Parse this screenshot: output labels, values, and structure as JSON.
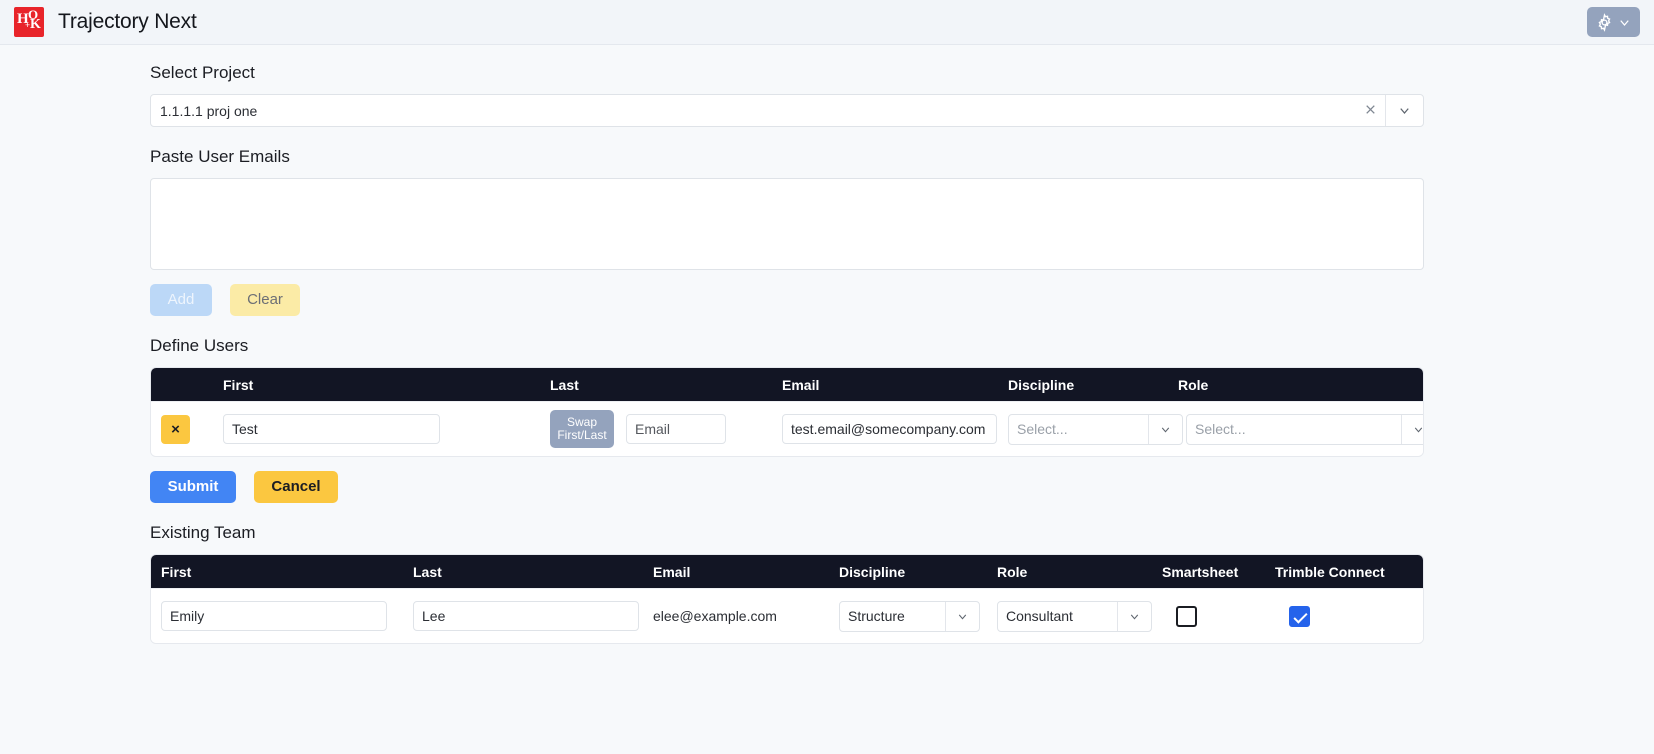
{
  "header": {
    "logo_alt": "hok-logo",
    "title": "Trajectory Next",
    "settings_icon": "gear-icon",
    "settings_chevron": "chevron-down-icon"
  },
  "project": {
    "label": "Select Project",
    "selected_value": "1.1.1.1 proj one",
    "clear_icon": "close-icon",
    "dropdown_icon": "chevron-down-icon"
  },
  "paste_emails": {
    "label": "Paste User Emails",
    "value": "",
    "placeholder": "",
    "add_label": "Add",
    "clear_label": "Clear"
  },
  "define_users": {
    "label": "Define Users",
    "columns": [
      "First",
      "Last",
      "Email",
      "Discipline",
      "Role"
    ],
    "rows": [
      {
        "remove_label": "×",
        "first": "Test",
        "swap_label_line1": "Swap",
        "swap_label_line2": "First/Last",
        "last": "",
        "last_placeholder": "Email",
        "email": "test.email@somecompany.com",
        "discipline": "Select...",
        "role": "Select..."
      }
    ],
    "submit_label": "Submit",
    "cancel_label": "Cancel"
  },
  "existing_team": {
    "label": "Existing Team",
    "columns": [
      "First",
      "Last",
      "Email",
      "Discipline",
      "Role",
      "Smartsheet",
      "Trimble Connect"
    ],
    "rows": [
      {
        "first": "Emily",
        "last": "Lee",
        "email": "elee@example.com",
        "discipline": "Structure",
        "role": "Consultant",
        "smartsheet": false,
        "trimble_connect": true
      }
    ]
  },
  "colors": {
    "accent_blue": "#4285f4",
    "accent_yellow": "#fbc740",
    "table_header_bg": "#121524",
    "logo_red": "#e8242a",
    "checkbox_on": "#2563eb"
  }
}
